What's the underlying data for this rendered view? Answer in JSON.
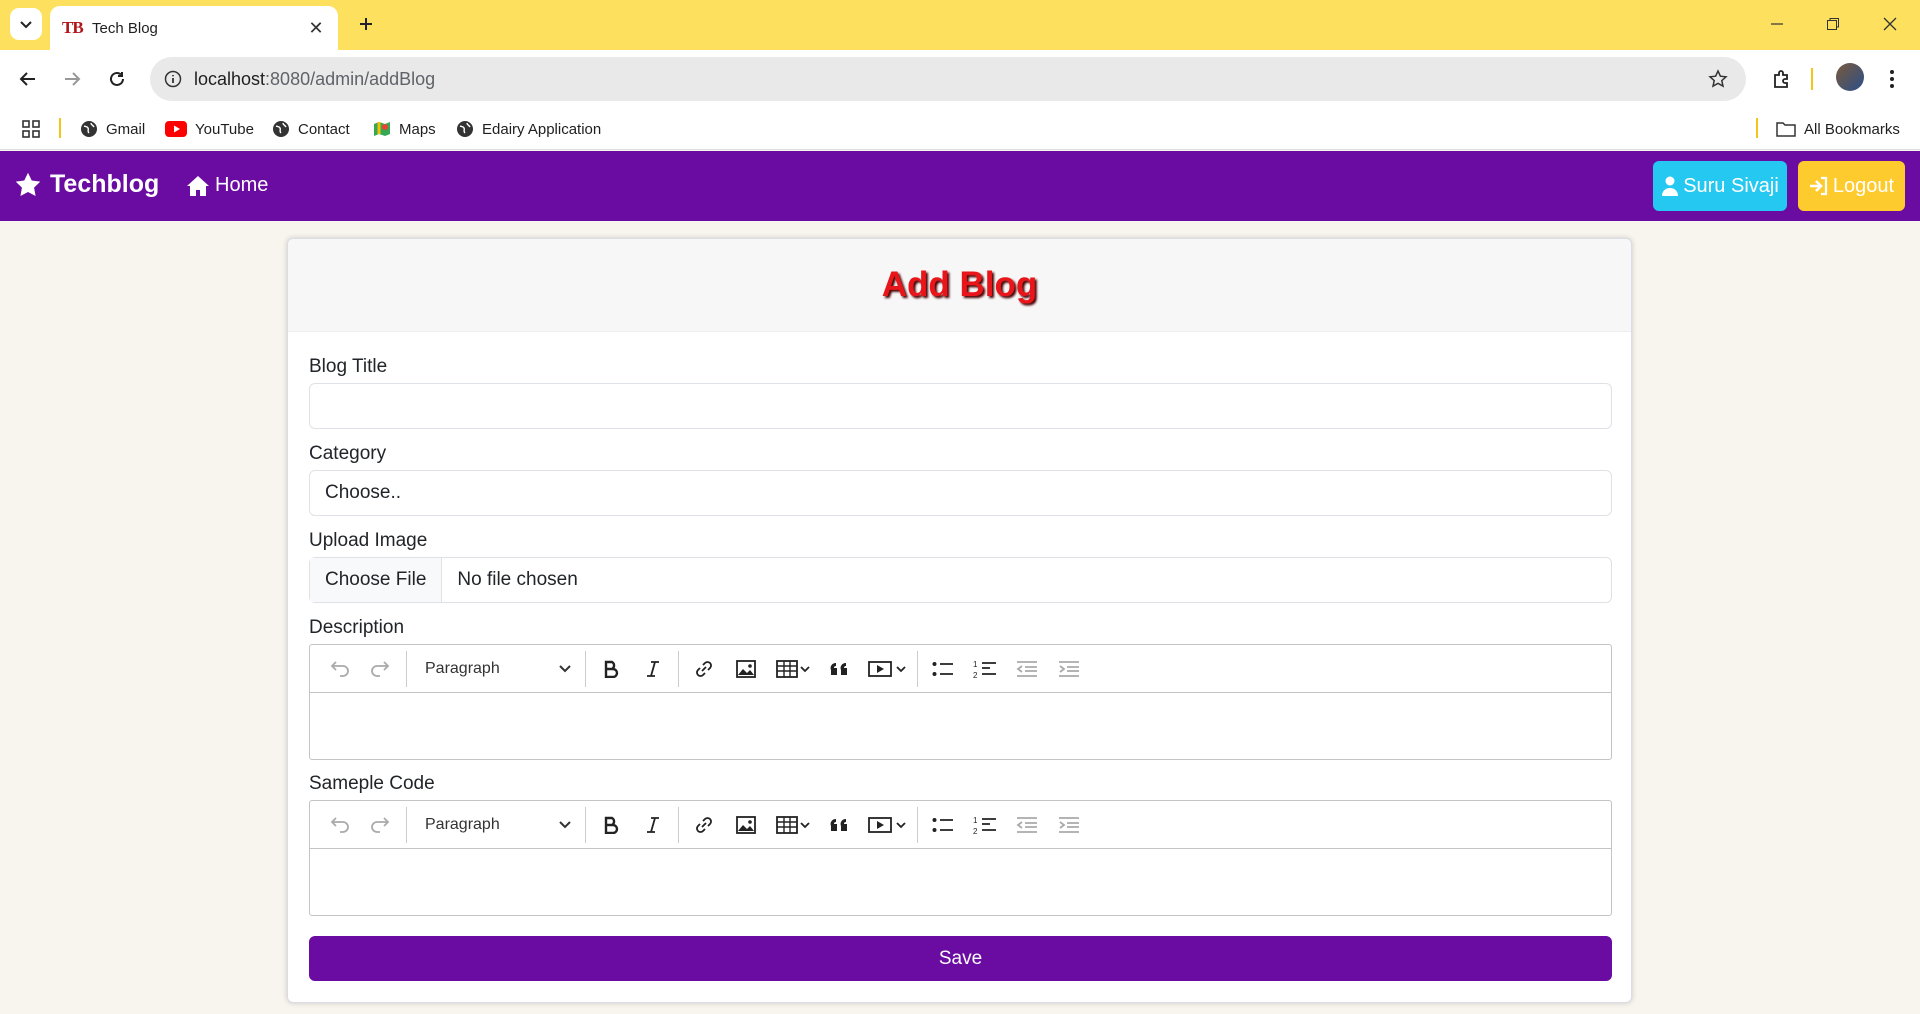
{
  "browser": {
    "tab_title": "Tech Blog",
    "tab_favicon": "TB",
    "url_host": "localhost",
    "url_path": ":8080/admin/addBlog",
    "bookmarks": [
      {
        "label": "Gmail",
        "icon": "globe-icon"
      },
      {
        "label": "YouTube",
        "icon": "youtube-icon"
      },
      {
        "label": "Contact",
        "icon": "globe-icon"
      },
      {
        "label": "Maps",
        "icon": "maps-icon"
      },
      {
        "label": "Edairy Application",
        "icon": "globe-icon"
      }
    ],
    "all_bookmarks": "All Bookmarks",
    "tab_strip_color": "#fde15e"
  },
  "navbar": {
    "brand": "Techblog",
    "home": "Home",
    "user": "Suru Sivaji",
    "logout": "Logout",
    "bg_color": "#6a0ba1"
  },
  "form": {
    "title": "Add Blog",
    "blog_title_label": "Blog Title",
    "blog_title_value": "",
    "category_label": "Category",
    "category_selected": "Choose..",
    "upload_label": "Upload Image",
    "choose_file": "Choose File",
    "no_file": "No file chosen",
    "description_label": "Description",
    "sample_code_label": "Sameple Code",
    "editor_heading": "Paragraph",
    "save": "Save"
  }
}
